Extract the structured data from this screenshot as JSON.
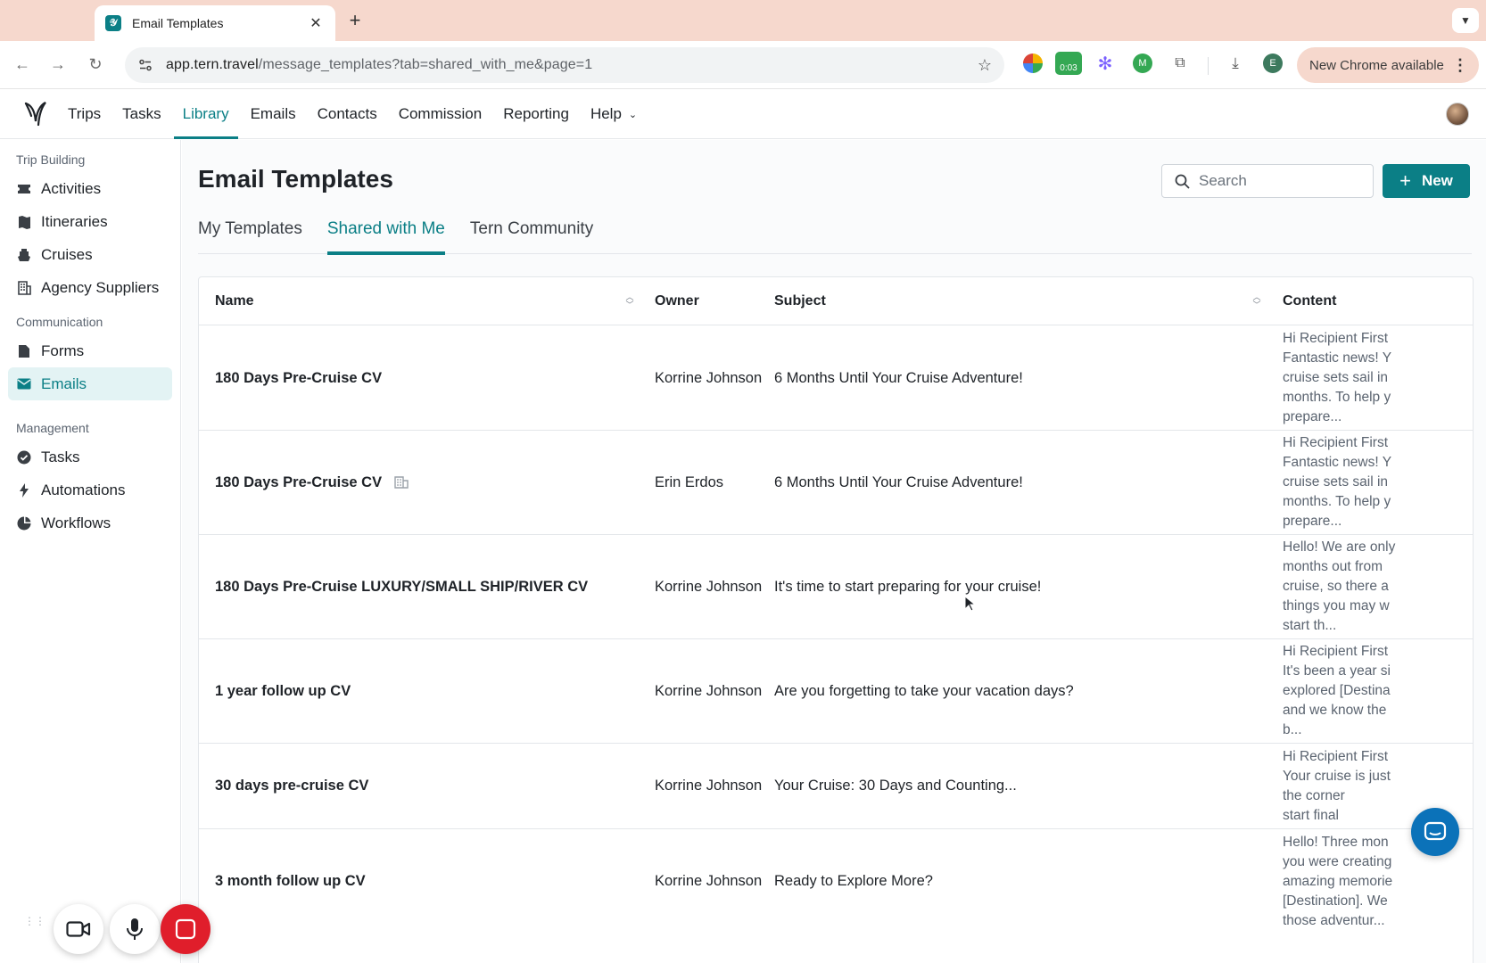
{
  "browser": {
    "tab_title": "Email Templates",
    "url_host": "app.tern.travel",
    "url_path": "/message_templates?tab=shared_with_me&page=1",
    "ext_timer": "0:03",
    "ext_m_label": "M",
    "profile_initial": "E",
    "update_label": "New Chrome available"
  },
  "nav": {
    "items": [
      {
        "label": "Trips"
      },
      {
        "label": "Tasks"
      },
      {
        "label": "Library"
      },
      {
        "label": "Emails"
      },
      {
        "label": "Contacts"
      },
      {
        "label": "Commission"
      },
      {
        "label": "Reporting"
      },
      {
        "label": "Help"
      }
    ],
    "active": "Library"
  },
  "sidebar": {
    "sections": [
      {
        "title": "Trip Building",
        "items": [
          "Activities",
          "Itineraries",
          "Cruises",
          "Agency Suppliers"
        ]
      },
      {
        "title": "Communication",
        "items": [
          "Forms",
          "Emails"
        ]
      },
      {
        "title": "Management",
        "items": [
          "Tasks",
          "Automations",
          "Workflows"
        ]
      }
    ],
    "active": "Emails"
  },
  "main": {
    "title": "Email Templates",
    "search_placeholder": "Search",
    "new_label": "New",
    "tabs": [
      "My Templates",
      "Shared with Me",
      "Tern Community"
    ],
    "active_tab": "Shared with Me"
  },
  "table": {
    "columns": [
      "Name",
      "Owner",
      "Subject",
      "Content"
    ],
    "rows": [
      {
        "name": "180 Days Pre-Cruise CV",
        "owner": "Korrine Johnson",
        "subject": "6 Months Until Your Cruise Adventure!",
        "content": "Hi Recipient First\nFantastic news! Y\ncruise sets sail in\nmonths. To help y\nprepare..."
      },
      {
        "name": "180 Days Pre-Cruise CV",
        "shared": true,
        "owner": "Erin Erdos",
        "subject": "6 Months Until Your Cruise Adventure!",
        "content": "Hi Recipient First\nFantastic news! Y\ncruise sets sail in\nmonths. To help y\nprepare..."
      },
      {
        "name": "180 Days Pre-Cruise LUXURY/SMALL SHIP/RIVER CV",
        "owner": "Korrine Johnson",
        "subject": "It's time to start preparing for your cruise!",
        "content": "Hello! We are only\nmonths out from\ncruise, so there a\nthings you may w\nstart th..."
      },
      {
        "name": "1 year follow up CV",
        "owner": "Korrine Johnson",
        "subject": "Are you forgetting to take your vacation days?",
        "content": "Hi Recipient First\nIt's been a year si\nexplored [Destina\nand we know the\nb..."
      },
      {
        "name": "30 days pre-cruise CV",
        "owner": "Korrine Johnson",
        "subject": "Your Cruise: 30 Days and Counting...",
        "content": "Hi Recipient First\nYour cruise is just\nthe corner\nstart final"
      },
      {
        "name": "3 month follow up CV",
        "owner": "Korrine Johnson",
        "subject": "Ready to Explore More?",
        "content": "Hello! Three mon\nyou were creating\namazing memorie\n[Destination]. We\nthose adventur..."
      }
    ]
  },
  "colors": {
    "accent": "#0b7f86",
    "tabstrip": "#f6d8cd",
    "record_stop": "#e01e2b",
    "chat_fab": "#0b72b9"
  }
}
